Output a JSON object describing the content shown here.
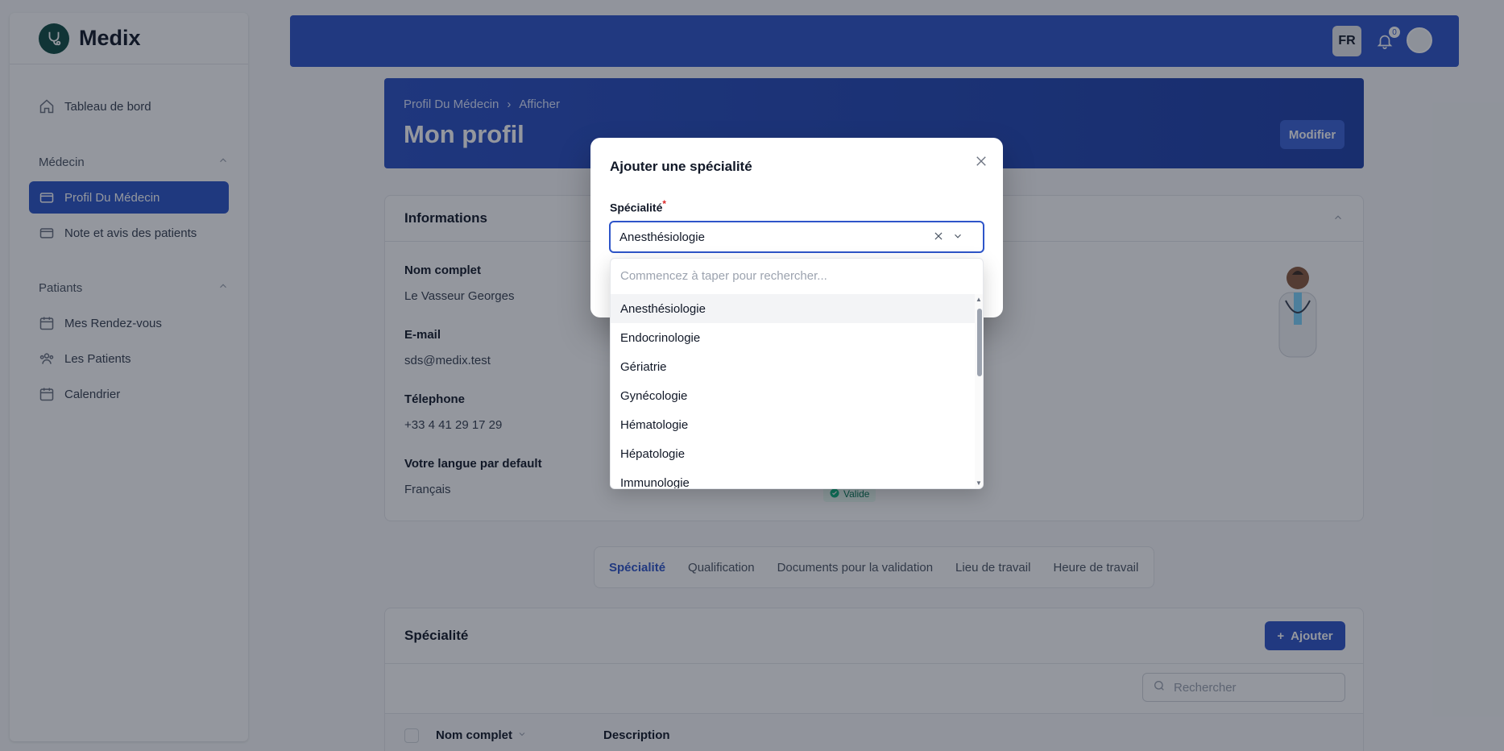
{
  "brand": {
    "name": "Medix",
    "logo_icon": "stethoscope-logo-icon"
  },
  "sidebar": {
    "dashboard": "Tableau de bord",
    "groups": [
      {
        "label": "Médecin",
        "items": [
          "Profil Du Médecin",
          "Note et avis des patients"
        ]
      },
      {
        "label": "Patiants",
        "items": [
          "Mes Rendez-vous",
          "Les Patients",
          "Calendrier"
        ]
      }
    ]
  },
  "header": {
    "lang": "FR",
    "notifications": "0"
  },
  "profile": {
    "breadcrumb": [
      "Profil Du Médecin",
      "Afficher"
    ],
    "title": "Mon profil",
    "edit_label": "Modifier"
  },
  "info": {
    "title": "Informations",
    "fields": [
      {
        "label": "Nom complet",
        "value": "Le Vasseur Georges"
      },
      {
        "label": "E-mail",
        "value": "sds@medix.test"
      },
      {
        "label": "Télephone",
        "value": "+33 4 41 29 17 29"
      },
      {
        "label": "Votre langue par default",
        "value": "Français"
      }
    ],
    "status": "Valide"
  },
  "tabs": [
    "Spécialité",
    "Qualification",
    "Documents pour la validation",
    "Lieu de travail",
    "Heure de travail"
  ],
  "specialty_section": {
    "title": "Spécialité",
    "add_label": "Ajouter",
    "search_placeholder": "Rechercher",
    "columns": [
      "Nom complet",
      "Description"
    ]
  },
  "modal": {
    "title": "Ajouter une spécialité",
    "field_label": "Spécialité",
    "required_mark": "*",
    "selected": "Anesthésiologie",
    "dropdown_placeholder": "Commencez à taper pour rechercher...",
    "options": [
      "Anesthésiologie",
      "Endocrinologie",
      "Gériatrie",
      "Gynécologie",
      "Hématologie",
      "Hépatologie",
      "Immunologie"
    ]
  },
  "colors": {
    "primary": "#2e55c9",
    "sidebar_active": "#2b55c6"
  }
}
